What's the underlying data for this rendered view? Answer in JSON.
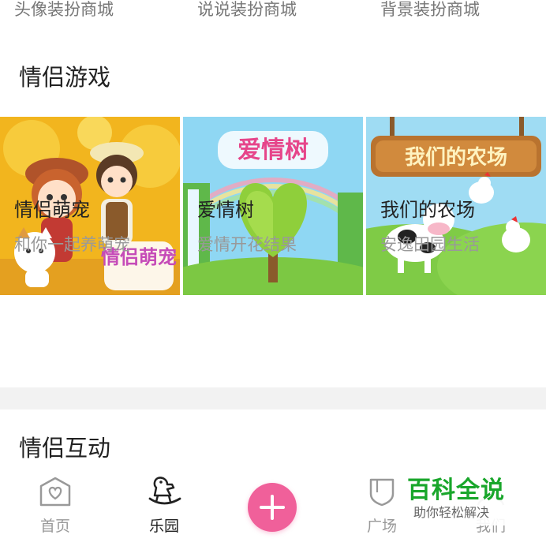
{
  "top_links": [
    "头像装扮商城",
    "说说装扮商城",
    "背景装扮商城"
  ],
  "sections": {
    "games_title": "情侣游戏",
    "interaction_title": "情侣互动"
  },
  "games": [
    {
      "name": "情侣萌宠",
      "desc": "和你一起养萌宠",
      "thumb_text": "情侣萌宠"
    },
    {
      "name": "爱情树",
      "desc": "爱情开花结果",
      "thumb_text": "爱情树"
    },
    {
      "name": "我们的农场",
      "desc": "安逸田园生活",
      "thumb_text": "我们的农场"
    }
  ],
  "tabbar": {
    "items": [
      {
        "label": "首页",
        "icon": "home-heart-icon"
      },
      {
        "label": "乐园",
        "icon": "rocking-horse-icon",
        "active": true
      },
      {
        "label": "",
        "icon": "plus-icon"
      },
      {
        "label": "广场",
        "icon": "square-icon"
      },
      {
        "label": "我们",
        "icon": "us-icon"
      }
    ]
  },
  "watermark": {
    "title": "百科全说",
    "subtitle": "助你轻松解决"
  },
  "colors": {
    "accent": "#f0609a",
    "watermark_green": "#19a62b"
  }
}
